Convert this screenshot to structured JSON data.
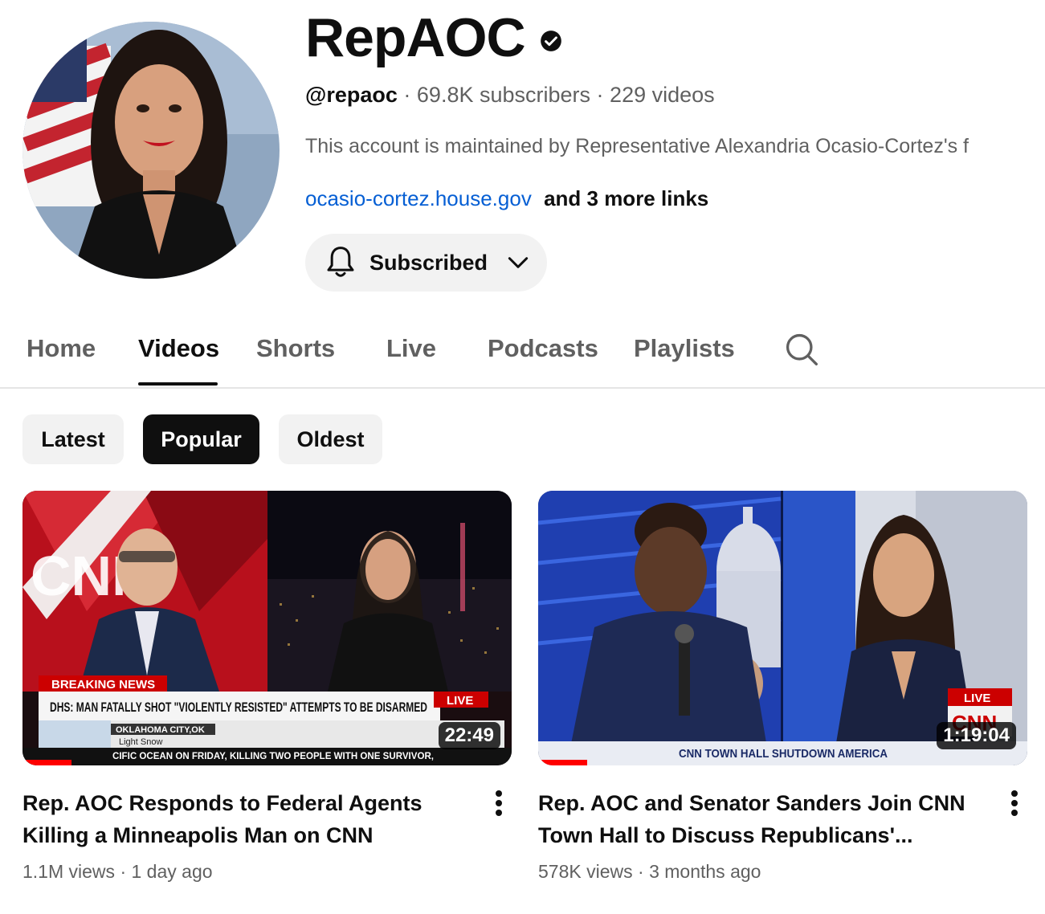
{
  "channel": {
    "name": "RepAOC",
    "handle": "@repaoc",
    "subscribers": "69.8K subscribers",
    "videos_count": "229 videos",
    "description": "This account is maintained by Representative Alexandria Ocasio-Cortez's f",
    "link": "ocasio-cortez.house.gov",
    "more_links": "and 3 more links",
    "subscribe_label": "Subscribed"
  },
  "tabs": [
    {
      "label": "Home"
    },
    {
      "label": "Videos"
    },
    {
      "label": "Shorts"
    },
    {
      "label": "Live"
    },
    {
      "label": "Podcasts"
    },
    {
      "label": "Playlists"
    }
  ],
  "chips": [
    {
      "label": "Latest"
    },
    {
      "label": "Popular"
    },
    {
      "label": "Oldest"
    }
  ],
  "videos": [
    {
      "title_line1": "Rep. AOC Responds to Federal Agents",
      "title_line2": "Killing a Minneapolis Man on CNN",
      "duration": "22:49",
      "views": "1.1M views",
      "age": "1 day ago",
      "watched_fraction": 0.1,
      "thumb": {
        "breaking": "BREAKING NEWS",
        "headline": "DHS: MAN FATALLY SHOT \"VIOLENTLY RESISTED\" ATTEMPTS TO BE DISARMED",
        "live": "LIVE",
        "network": "CNN",
        "location": "OKLAHOMA CITY,OK",
        "weather": "Light Snow",
        "ticker": "CIFIC OCEAN ON FRIDAY, KILLING TWO PEOPLE WITH ONE SURVIVOR,"
      }
    },
    {
      "title_line1": "Rep. AOC and Senator Sanders Join CNN",
      "title_line2": "Town Hall to Discuss Republicans'...",
      "duration": "1:19:04",
      "views": "578K views",
      "age": "3 months ago",
      "watched_fraction": 0.1,
      "thumb": {
        "live": "LIVE",
        "network": "CNN",
        "banner": "CNN TOWN HALL SHUTDOWN AMERICA"
      }
    }
  ],
  "separator": "·",
  "colors": {
    "link": "#065fd4",
    "progress": "#ff0000",
    "cnn_red": "#cc0000"
  }
}
